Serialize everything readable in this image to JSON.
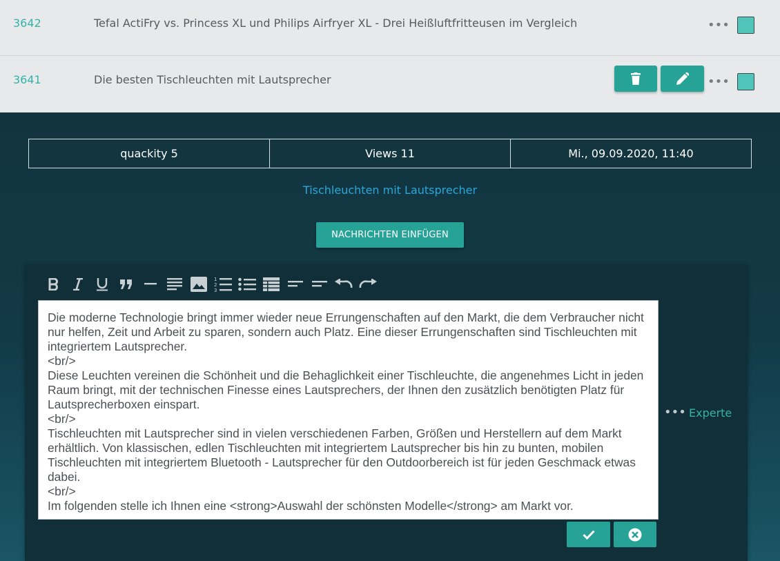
{
  "rows": [
    {
      "id": "3642",
      "title": "Tefal ActiFry vs. Princess XL und Philips Airfryer XL - Drei Heißluftfritteusen im Vergleich"
    },
    {
      "id": "3641",
      "title": "Die besten Tischleuchten mit Lautsprecher"
    }
  ],
  "more_glyph": "•••",
  "info": {
    "author": "quackity 5",
    "views": "Views 11",
    "date": "Mi., 09.09.2020, 11:40"
  },
  "post_link": "Tischleuchten mit Lautsprecher",
  "insert_button": "NACHRICHTEN EINFÜGEN",
  "toolbar": [
    "bold-icon",
    "italic-icon",
    "underline-icon",
    "quote-icon",
    "horizontal-rule-icon",
    "align-justify-icon",
    "image-icon",
    "ordered-list-icon",
    "unordered-list-icon",
    "table-icon",
    "align-left-icon",
    "align-right-icon",
    "undo-icon",
    "redo-icon"
  ],
  "editor_text": "Die moderne Technologie bringt immer wieder neue Errungenschaften auf den Markt, die dem Verbraucher nicht nur helfen, Zeit und Arbeit zu sparen, sondern auch Platz. Eine dieser Errungenschaften sind Tischleuchten mit integriertem Lautsprecher.\n<br/>\nDiese Leuchten vereinen die Schönheit und die Behaglichkeit einer Tischleuchte, die angenehmes Licht in jeden Raum bringt, mit der technischen Finesse eines Lautsprechers, der Ihnen den zusätzlich benötigten Platz für Lautsprecherboxen einspart.\n<br/>\nTischleuchten mit Lautsprecher sind in vielen verschiedenen Farben, Größen und Herstellern auf dem Markt erhältlich. Von klassischen, edlen Tischleuchten mit integriertem Lautsprecher bis hin zu bunten, mobilen Tischleuchten mit integriertem Bluetooth - Lautsprecher für den Outdoorbereich ist für jeden Geschmack etwas dabei.\n<br/>\nIm folgenden stelle ich Ihnen eine <strong>Auswahl der schönsten Modelle</strong> am Markt vor.",
  "expert_label": "Experte",
  "colors": {
    "accent": "#26a396",
    "link_teal": "#34b3a6",
    "link_blue": "#2aa7d8",
    "dark_bg": "#12343f",
    "list_bg": "#e8e9eb",
    "checkbox": "#52c5ba"
  }
}
